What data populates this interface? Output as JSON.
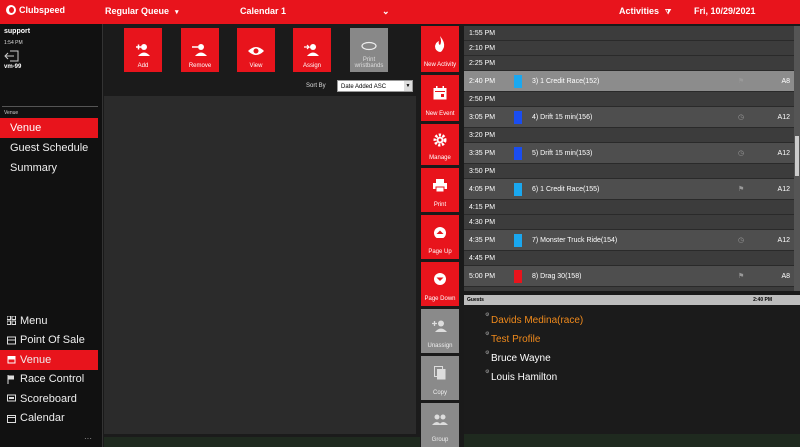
{
  "topbar": {
    "brand": "Clubspeed",
    "queue_label": "Regular Queue",
    "calendar_label": "Calendar 1",
    "calendar_caret": "⌄",
    "activities_label": "Activities",
    "date": "Fri, 10/29/2021",
    "accent": "#e8141c"
  },
  "user": {
    "name": "support",
    "time": "1:54 PM",
    "terminal": "vm-99"
  },
  "venue_section": {
    "label": "Venue",
    "items": [
      {
        "label": "Venue",
        "active": true
      },
      {
        "label": "Guest Schedule",
        "active": false
      },
      {
        "label": "Summary",
        "active": false
      }
    ]
  },
  "main_nav": [
    {
      "label": "Menu",
      "icon": "grid-icon"
    },
    {
      "label": "Point Of Sale",
      "icon": "register-icon"
    },
    {
      "label": "Venue",
      "icon": "store-icon",
      "active": true
    },
    {
      "label": "Race Control",
      "icon": "flag-icon"
    },
    {
      "label": "Scoreboard",
      "icon": "scoreboard-icon"
    },
    {
      "label": "Calendar",
      "icon": "calendar-icon"
    }
  ],
  "queue_toolbar": {
    "add": "Add",
    "remove": "Remove",
    "view": "View",
    "assign": "Assign",
    "print_wristbands": "Print wristbands",
    "sort_by_label": "Sort By",
    "sort_value": "Date Added ASC"
  },
  "actions": {
    "new_activity": "New Activity",
    "new_event": "New Event",
    "manage": "Manage",
    "print": "Print",
    "page_up": "Page Up",
    "page_down": "Page Down",
    "unassign": "Unassign",
    "copy": "Copy",
    "group": "Group"
  },
  "schedule": [
    {
      "time": "1:55 PM",
      "kind": "slot"
    },
    {
      "time": "2:10 PM",
      "kind": "slot"
    },
    {
      "time": "2:25 PM",
      "kind": "slot"
    },
    {
      "time": "2:40 PM",
      "kind": "event",
      "selected": true,
      "color": "#1aa8f0",
      "name": "3) 1 Credit Race(152)",
      "icon": "flag-icon",
      "code": "A8"
    },
    {
      "time": "2:50 PM",
      "kind": "slot"
    },
    {
      "time": "3:05 PM",
      "kind": "event",
      "color": "#1a4df0",
      "name": "4) Drift 15 min(156)",
      "icon": "clock-icon",
      "code": "A12"
    },
    {
      "time": "3:20 PM",
      "kind": "slot"
    },
    {
      "time": "3:35 PM",
      "kind": "event",
      "color": "#1a4df0",
      "name": "5) Drift 15 min(153)",
      "icon": "clock-icon",
      "code": "A12"
    },
    {
      "time": "3:50 PM",
      "kind": "slot"
    },
    {
      "time": "4:05 PM",
      "kind": "event",
      "color": "#1aa8f0",
      "name": "6) 1 Credit Race(155)",
      "icon": "flag-icon",
      "code": "A12"
    },
    {
      "time": "4:15 PM",
      "kind": "slot"
    },
    {
      "time": "4:30 PM",
      "kind": "slot"
    },
    {
      "time": "4:35 PM",
      "kind": "event",
      "color": "#1aa8f0",
      "name": "7) Monster Truck Ride(154)",
      "icon": "clock-icon",
      "code": "A12"
    },
    {
      "time": "4:45 PM",
      "kind": "slot"
    },
    {
      "time": "5:00 PM",
      "kind": "event",
      "color": "#e8141c",
      "name": "8) Drag 30(158)",
      "icon": "flag-icon",
      "code": "A8"
    }
  ],
  "guests": {
    "header": "Guests",
    "time": "2:40 PM",
    "list": [
      {
        "name": "Davids Medina(race)",
        "highlight": true
      },
      {
        "name": "Test Profile",
        "highlight": true
      },
      {
        "name": "Bruce Wayne",
        "highlight": false
      },
      {
        "name": "Louis Hamilton",
        "highlight": false
      }
    ]
  }
}
